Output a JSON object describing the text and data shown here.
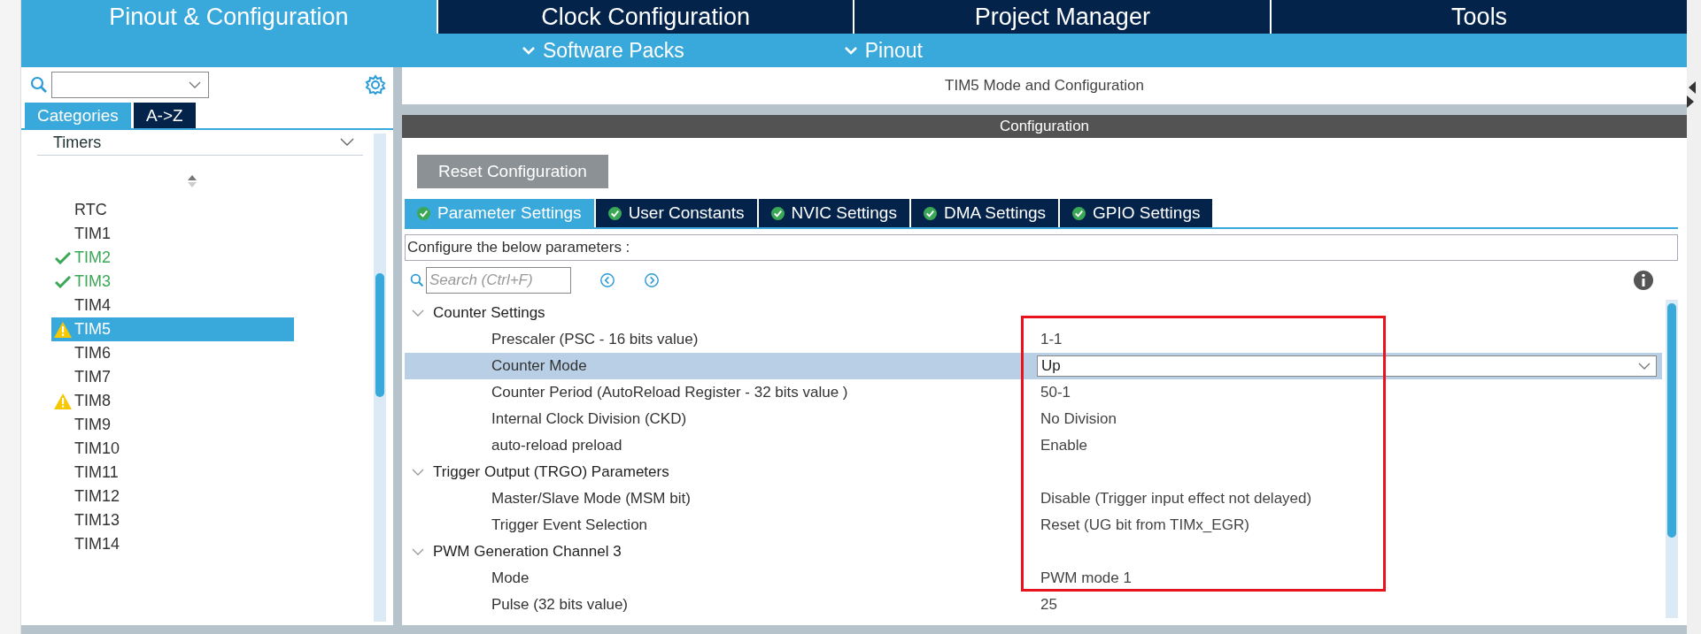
{
  "main_tabs": [
    {
      "label": "Pinout & Configuration",
      "selected": true
    },
    {
      "label": "Clock Configuration",
      "selected": false
    },
    {
      "label": "Project Manager",
      "selected": false
    },
    {
      "label": "Tools",
      "selected": false
    }
  ],
  "sub_menus": [
    {
      "label": "Software Packs"
    },
    {
      "label": "Pinout"
    }
  ],
  "sidebar": {
    "view_tabs": [
      {
        "label": "Categories",
        "selected": true
      },
      {
        "label": "A->Z",
        "selected": false
      }
    ],
    "category": {
      "label": "Timers",
      "expanded": true
    },
    "items": [
      {
        "label": "RTC",
        "kind": "plain",
        "selected": false
      },
      {
        "label": "TIM1",
        "kind": "plain",
        "selected": false
      },
      {
        "label": "TIM2",
        "kind": "ok",
        "selected": false
      },
      {
        "label": "TIM3",
        "kind": "ok",
        "selected": false
      },
      {
        "label": "TIM4",
        "kind": "plain",
        "selected": false
      },
      {
        "label": "TIM5",
        "kind": "warning",
        "selected": true
      },
      {
        "label": "TIM6",
        "kind": "plain",
        "selected": false
      },
      {
        "label": "TIM7",
        "kind": "plain",
        "selected": false
      },
      {
        "label": "TIM8",
        "kind": "warning",
        "selected": false
      },
      {
        "label": "TIM9",
        "kind": "plain",
        "selected": false
      },
      {
        "label": "TIM10",
        "kind": "plain",
        "selected": false
      },
      {
        "label": "TIM11",
        "kind": "plain",
        "selected": false
      },
      {
        "label": "TIM12",
        "kind": "plain",
        "selected": false
      },
      {
        "label": "TIM13",
        "kind": "plain",
        "selected": false
      },
      {
        "label": "TIM14",
        "kind": "plain",
        "selected": false
      }
    ]
  },
  "panel": {
    "title": "TIM5 Mode and Configuration",
    "section": "Configuration",
    "reset_button": "Reset Configuration",
    "tabs": [
      {
        "label": "Parameter Settings",
        "selected": true
      },
      {
        "label": "User Constants",
        "selected": false
      },
      {
        "label": "NVIC Settings",
        "selected": false
      },
      {
        "label": "DMA Settings",
        "selected": false
      },
      {
        "label": "GPIO Settings",
        "selected": false
      }
    ],
    "hint": "Configure the below parameters :",
    "search": {
      "placeholder": "Search (Ctrl+F)"
    },
    "parameters": [
      {
        "kind": "group",
        "label": "Counter Settings",
        "expanded": true
      },
      {
        "kind": "param",
        "label": "Prescaler (PSC - 16 bits value)",
        "value": "1-1",
        "selected": false
      },
      {
        "kind": "dropdown",
        "label": "Counter Mode",
        "value": "Up",
        "selected": true
      },
      {
        "kind": "param",
        "label": "Counter Period (AutoReload Register - 32 bits value )",
        "value": "50-1",
        "selected": false
      },
      {
        "kind": "param",
        "label": "Internal Clock Division (CKD)",
        "value": "No Division",
        "selected": false
      },
      {
        "kind": "param",
        "label": "auto-reload preload",
        "value": "Enable",
        "selected": false
      },
      {
        "kind": "group",
        "label": "Trigger Output (TRGO) Parameters",
        "expanded": true
      },
      {
        "kind": "param",
        "label": "Master/Slave Mode (MSM bit)",
        "value": "Disable (Trigger input effect not delayed)",
        "selected": false
      },
      {
        "kind": "param",
        "label": "Trigger Event Selection",
        "value": "Reset (UG bit from TIMx_EGR)",
        "selected": false
      },
      {
        "kind": "group",
        "label": "PWM Generation Channel 3",
        "expanded": true
      },
      {
        "kind": "param",
        "label": "Mode",
        "value": "PWM mode 1",
        "selected": false
      },
      {
        "kind": "param",
        "label": "Pulse (32 bits value)",
        "value": "25",
        "selected": false
      }
    ]
  }
}
